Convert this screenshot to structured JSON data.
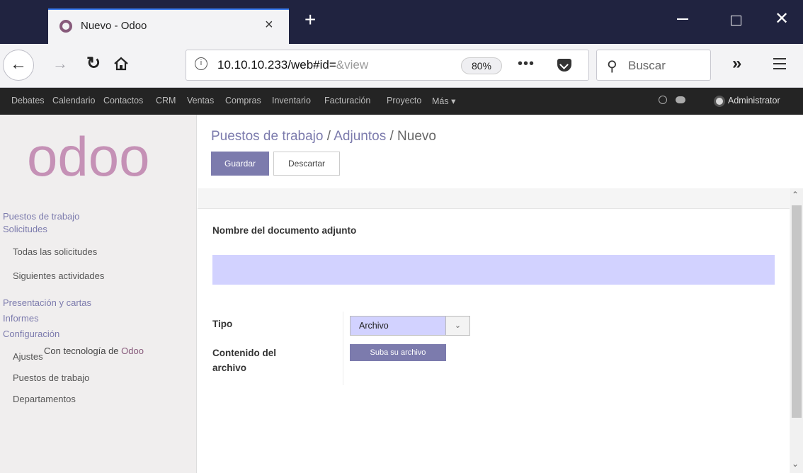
{
  "browser": {
    "tab_title": "Nuevo - Odoo",
    "tab_close": "×",
    "new_tab": "+",
    "url_host": "10.10.10.233",
    "url_path": "/web#id=",
    "url_dim": "&view",
    "zoom": "80%",
    "page_actions": "•••",
    "search_placeholder": "Buscar",
    "overflow": "»"
  },
  "odoo_menu": {
    "items": [
      "Debates",
      "Calendario",
      "Contactos",
      "CRM",
      "Ventas",
      "Compras",
      "Inventario",
      "Facturación",
      "Proyecto",
      "Más ▾"
    ],
    "user": "Administrator"
  },
  "sidebar": {
    "heading1": "Puestos de trabajo",
    "heading2": "Solicitudes",
    "solicitudes_items": [
      "Todas las solicitudes",
      "Siguientes actividades"
    ],
    "heading3": "Presentación y cartas",
    "heading4": "Informes",
    "heading5": "Configuración",
    "config_items": [
      "Ajustes",
      "Puestos de trabajo",
      "Departamentos"
    ],
    "powered_prefix": "Con tecnología de",
    "powered_brand": "Odoo",
    "logo_text": "odoo"
  },
  "breadcrumb": {
    "crumb1": "Puestos de trabajo",
    "crumb2": "Adjuntos",
    "current": "Nuevo",
    "sep": "/"
  },
  "actions": {
    "save": "Guardar",
    "discard": "Descartar"
  },
  "form": {
    "name_label": "Nombre del documento adjunto",
    "name_value": "",
    "tipo_label": "Tipo",
    "tipo_value": "Archivo",
    "content_label": "Contenido del archivo",
    "upload_button": "Suba su archivo"
  },
  "colors": {
    "brand": "#875a7b",
    "primary": "#7c7bad",
    "required_field": "#d2d2ff",
    "menu_bg": "#242424"
  }
}
